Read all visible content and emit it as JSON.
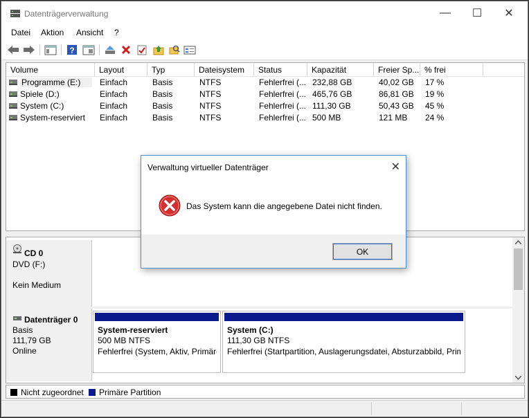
{
  "window": {
    "title": "Datenträgerverwaltung",
    "controls": {
      "minimize": "—",
      "maximize": "☐",
      "close": "✕"
    }
  },
  "menu": [
    "Datei",
    "Aktion",
    "Ansicht",
    "?"
  ],
  "toolbar_icons": [
    "back-arrow-icon",
    "forward-arrow-icon",
    "console-tree-icon",
    "help-icon",
    "properties-icon",
    "connect-disk-icon",
    "delete-icon",
    "check-icon",
    "folder-up-icon",
    "search-folder-icon",
    "view-icon"
  ],
  "volume_list": {
    "columns": [
      "Volume",
      "Layout",
      "Typ",
      "Dateisystem",
      "Status",
      "Kapazität",
      "Freier Sp...",
      "% frei"
    ],
    "rows": [
      [
        "Programme (E:)",
        "Einfach",
        "Basis",
        "NTFS",
        "Fehlerfrei (...",
        "232,88 GB",
        "40,02 GB",
        "17 %"
      ],
      [
        "Spiele (D:)",
        "Einfach",
        "Basis",
        "NTFS",
        "Fehlerfrei (...",
        "465,76 GB",
        "86,81 GB",
        "19 %"
      ],
      [
        "System (C:)",
        "Einfach",
        "Basis",
        "NTFS",
        "Fehlerfrei (...",
        "111,30 GB",
        "50,43 GB",
        "45 %"
      ],
      [
        "System-reserviert",
        "Einfach",
        "Basis",
        "NTFS",
        "Fehlerfrei (...",
        "500 MB",
        "121 MB",
        "24 %"
      ]
    ]
  },
  "disks": {
    "cd": {
      "name": "CD 0",
      "type": "DVD (F:)",
      "state": "Kein Medium"
    },
    "disk0": {
      "name": "Datenträger 0",
      "type": "Basis",
      "size": "111,79 GB",
      "state": "Online",
      "partitions": [
        {
          "name": "System-reserviert",
          "size": "500 MB NTFS",
          "status": "Fehlerfrei (System, Aktiv, Primäre"
        },
        {
          "name": "System  (C:)",
          "size": "111,30 GB NTFS",
          "status": "Fehlerfrei (Startpartition, Auslagerungsdatei, Absturzabbild, Prim"
        }
      ]
    }
  },
  "legend": {
    "unallocated": "Nicht zugeordnet",
    "unallocated_color": "#000000",
    "primary": "Primäre Partition",
    "primary_color": "#0a1a8c"
  },
  "dialog": {
    "title": "Verwaltung virtueller Datenträger",
    "message": "Das System kann die angegebene Datei nicht finden.",
    "ok": "OK",
    "close": "✕"
  },
  "colors": {
    "error": "#d32f2f",
    "partition_bar": "#0a1a8c",
    "accent": "#2b6fd6"
  }
}
